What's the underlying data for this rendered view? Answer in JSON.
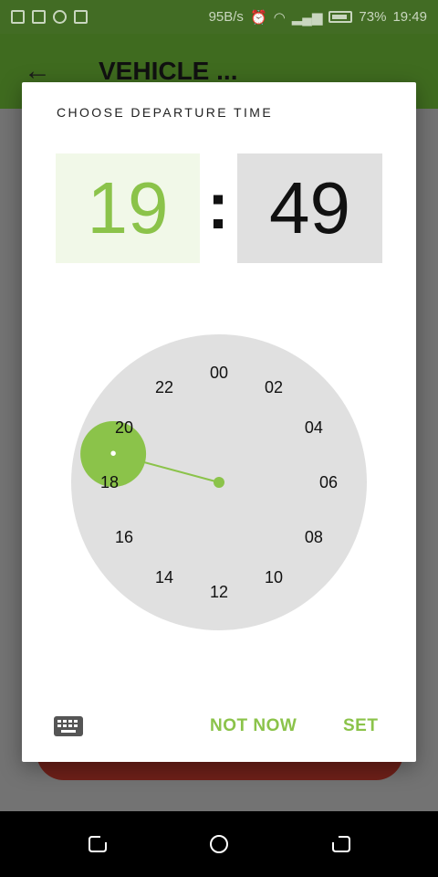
{
  "status_bar": {
    "speed": "95B/s",
    "battery_percent": "73%",
    "time": "19:49"
  },
  "app_bar": {
    "title": "VEHICLE ..."
  },
  "dialog": {
    "title": "CHOOSE DEPARTURE TIME",
    "hour": "19",
    "separator": ":",
    "minute": "49",
    "clock": {
      "labels": [
        "00",
        "02",
        "04",
        "06",
        "08",
        "10",
        "12",
        "14",
        "16",
        "18",
        "20",
        "22"
      ],
      "selected_hour": 19,
      "selection_dot": "•"
    },
    "buttons": {
      "not_now": "NOT NOW",
      "set": "SET"
    }
  },
  "colors": {
    "accent": "#8bc34a",
    "app_bar": "#3f6b1f",
    "status_bar": "#426c24",
    "clock_face": "#e0e0e0",
    "hour_box": "#f1f8e8",
    "minute_box": "#e0e0e0"
  }
}
